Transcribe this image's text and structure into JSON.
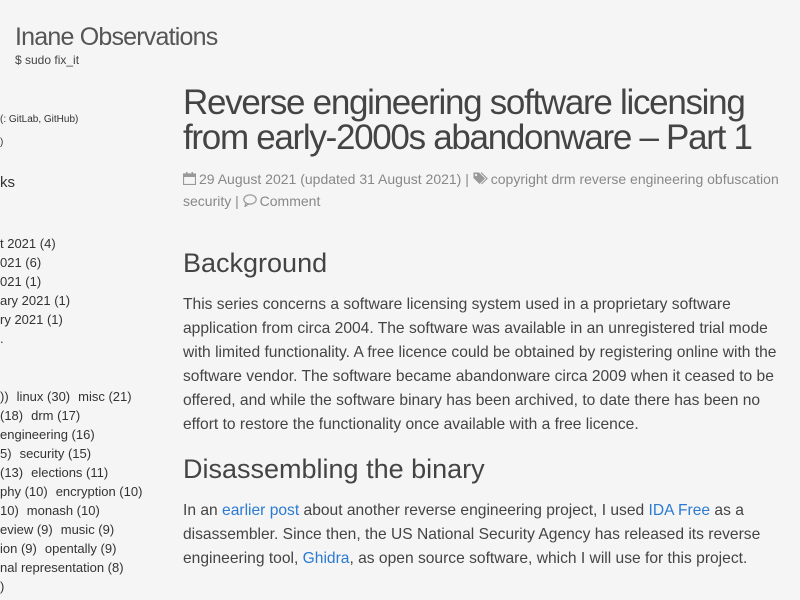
{
  "site": {
    "title": "Inane Observations",
    "tagline": "$ sudo fix_it"
  },
  "sidebar": {
    "links_line": "(: GitLab, GitHub)",
    "small_line": ")",
    "archives_heading": "ks",
    "archives": [
      "t 2021 (4)",
      "021 (6)",
      "021 (1)",
      "ary 2021 (1)",
      "ry 2021 (1)",
      "."
    ],
    "tag_rows": [
      [
        "))",
        "linux (30)",
        "misc (21)"
      ],
      [
        " (18)",
        "drm (17)"
      ],
      [
        "engineering (16)"
      ],
      [
        "5)",
        "security (15)"
      ],
      [
        " (13)",
        "elections (11)"
      ],
      [
        "phy (10)",
        "encryption (10)"
      ],
      [
        "10)",
        "monash (10)"
      ],
      [
        "eview (9)",
        "music (9)"
      ],
      [
        "ion (9)",
        "opentally (9)"
      ],
      [
        "nal representation (8)"
      ],
      [
        ")"
      ]
    ]
  },
  "post": {
    "title": "Reverse engineering software licensing from early-2000s abandonware – Part 1",
    "meta": {
      "date": "29 August 2021",
      "updated": "(updated 31 August 2021)",
      "sep": "|",
      "tags": [
        "copyright",
        "drm",
        "reverse engineering",
        "obfuscation",
        "security"
      ],
      "comment_label": "Comment"
    },
    "sections": [
      {
        "heading": "Background",
        "paragraph": "This series concerns a software licensing system used in a proprietary software application from circa 2004. The software was available in an unregistered trial mode with limited functionality. A free licence could be obtained by registering online with the software vendor. The software became abandonware circa 2009 when it ceased to be offered, and while the software binary has been archived, to date there has been no effort to restore the functionality once available with a free licence."
      },
      {
        "heading": "Disassembling the binary",
        "p_intro": "In an",
        "link_earlier": "earlier post",
        "p_mid1": "about another reverse engineering project, I used",
        "link_ida": "IDA Free",
        "p_mid2": "as a disassembler. Since then, the US National Security Agency has released its reverse engineering tool,",
        "link_ghidra": "Ghidra",
        "p_end": ", as open source software, which I will use for this project."
      }
    ]
  },
  "icons": {
    "calendar": "calendar-icon",
    "tags": "tags-icon",
    "comment": "comment-icon"
  },
  "colors": {
    "background": "#f5f5f5",
    "link": "#2a7ad2",
    "meta": "#888888",
    "text": "#444444"
  }
}
